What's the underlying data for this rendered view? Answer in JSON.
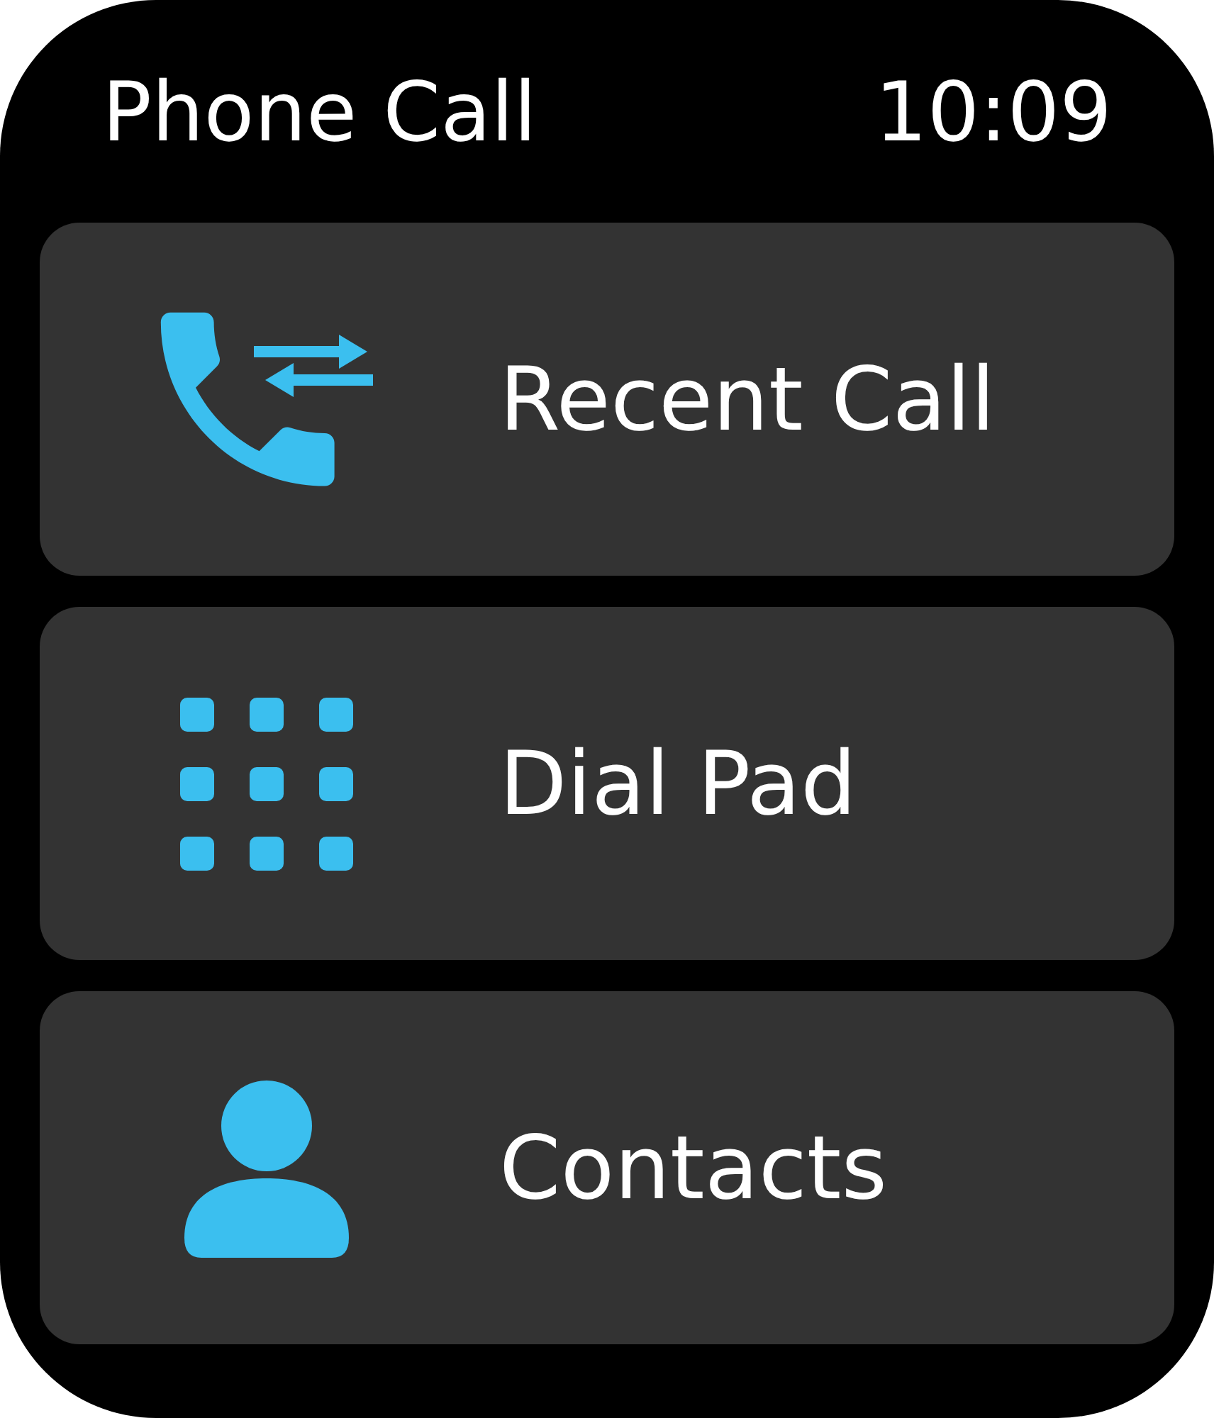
{
  "header": {
    "title": "Phone Call",
    "time": "10:09"
  },
  "items": [
    {
      "kind": "recent",
      "label": "Recent Call"
    },
    {
      "kind": "dialpad",
      "label": "Dial Pad"
    },
    {
      "kind": "contacts",
      "label": "Contacts"
    }
  ]
}
